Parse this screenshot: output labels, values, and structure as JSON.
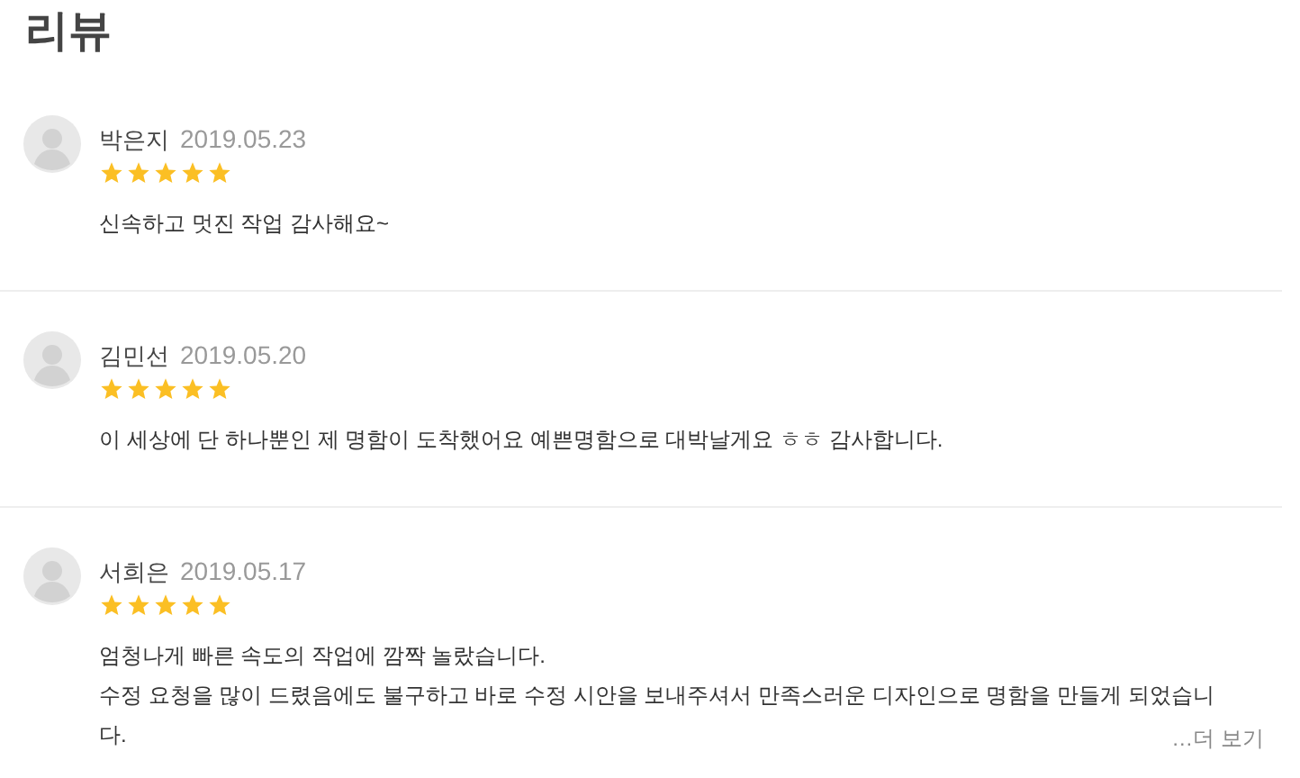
{
  "title": "리뷰",
  "reviews": [
    {
      "name": "박은지",
      "date": "2019.05.23",
      "stars": 5,
      "lines": [
        "신속하고 멋진 작업 감사해요~"
      ]
    },
    {
      "name": "김민선",
      "date": "2019.05.20",
      "stars": 5,
      "lines": [
        "이 세상에 단 하나뿐인 제 명함이 도착했어요 예쁜명함으로 대박날게요 ㅎㅎ 감사합니다."
      ]
    },
    {
      "name": "서희은",
      "date": "2019.05.17",
      "stars": 5,
      "lines": [
        "엄청나게 빠른 속도의 작업에 깜짝 놀랐습니다.",
        "수정 요청을 많이 드렸음에도 불구하고 바로 수정 시안을 보내주셔서 만족스러운 디자인으로 명함을 만들게 되었습니",
        "다."
      ],
      "more": "…더 보기"
    }
  ]
}
